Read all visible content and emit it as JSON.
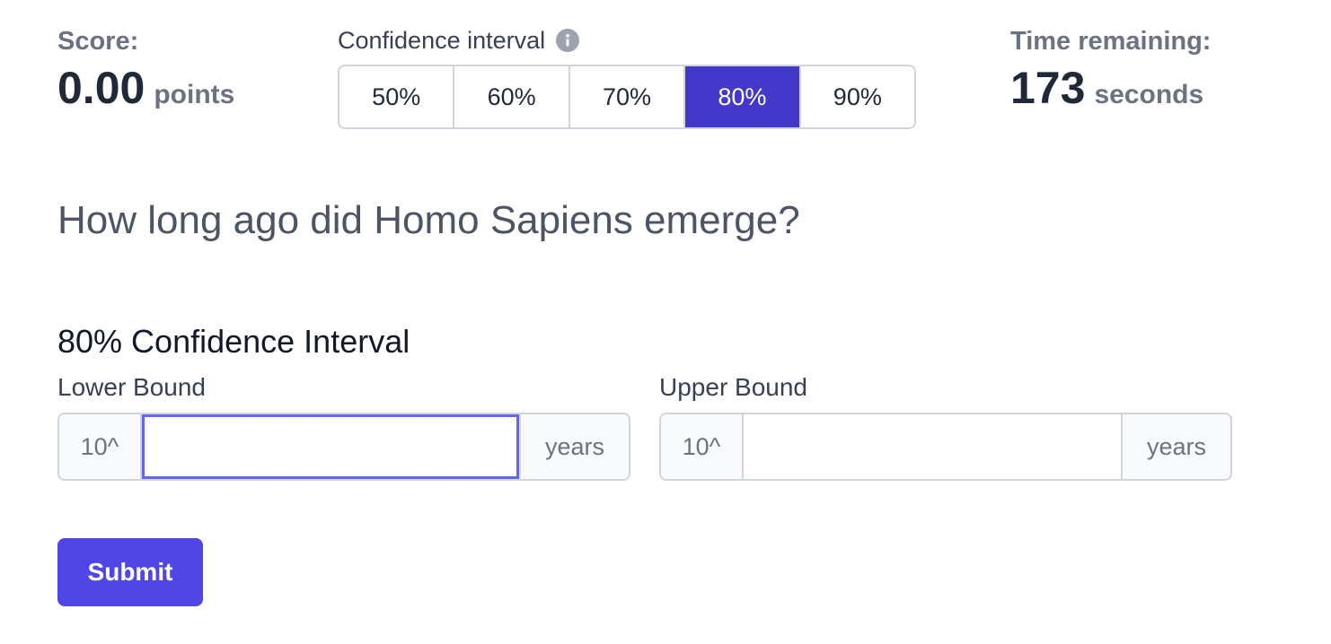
{
  "score": {
    "label": "Score:",
    "value": "0.00",
    "unit": "points"
  },
  "confidence": {
    "title": "Confidence interval",
    "options": [
      "50%",
      "60%",
      "70%",
      "80%",
      "90%"
    ],
    "selected": "80%"
  },
  "timer": {
    "label": "Time remaining:",
    "value": "173",
    "unit": "seconds"
  },
  "question": "How long ago did Homo Sapiens emerge?",
  "interval_heading": "80% Confidence Interval",
  "lower": {
    "label": "Lower Bound",
    "prefix": "10^",
    "value": "",
    "suffix": "years"
  },
  "upper": {
    "label": "Upper Bound",
    "prefix": "10^",
    "value": "",
    "suffix": "years"
  },
  "submit_label": "Submit",
  "colors": {
    "accent": "#4f46e5",
    "selected_segment": "#4338ca",
    "focus_ring": "#6366f1"
  }
}
